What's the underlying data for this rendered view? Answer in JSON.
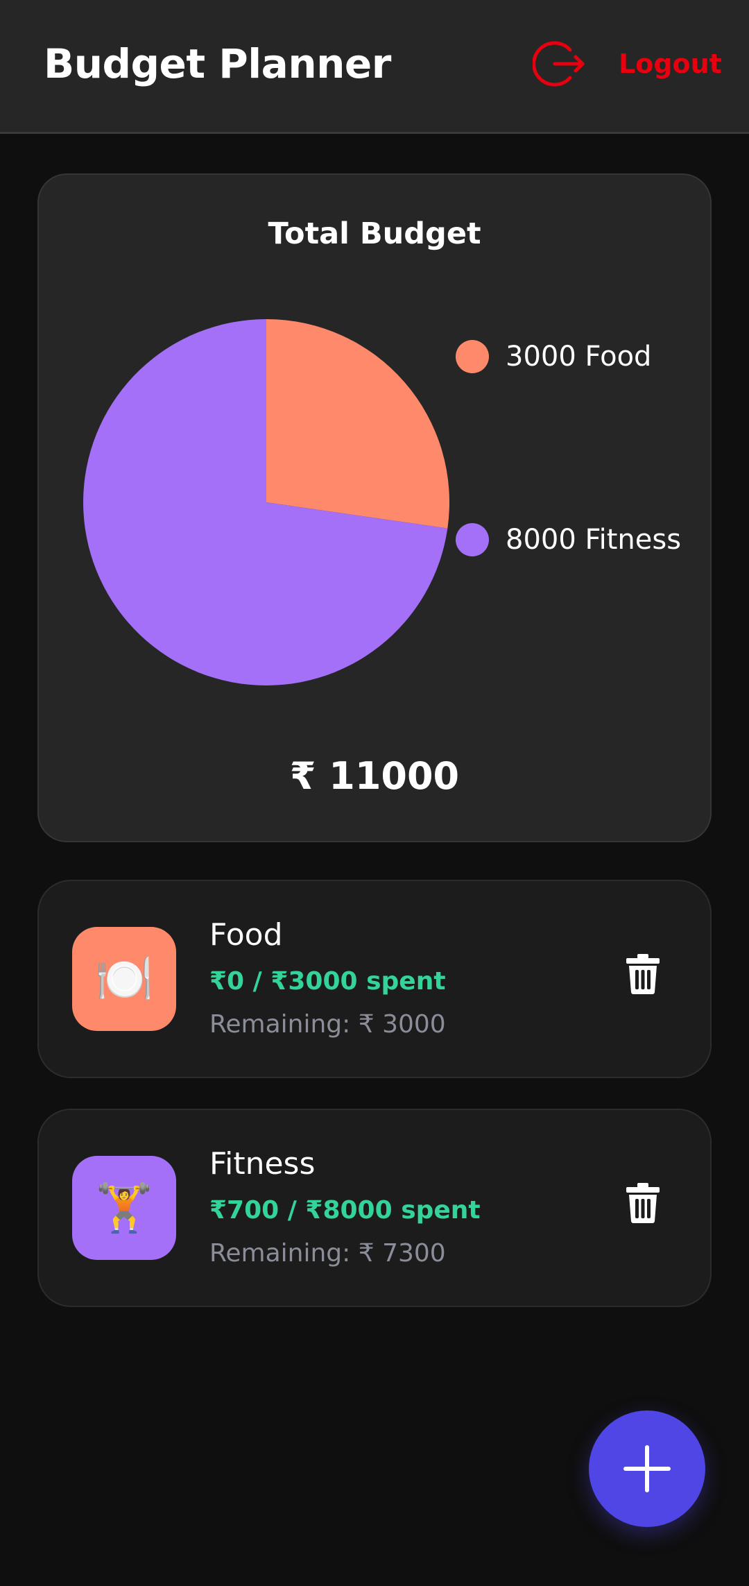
{
  "header": {
    "title": "Budget Planner",
    "logout_label": "Logout",
    "logout_icon": "logout-icon",
    "accent_color": "#e8000f"
  },
  "summary": {
    "title": "Total Budget",
    "total": "₹ 11000"
  },
  "chart_data": {
    "type": "pie",
    "title": "Total Budget",
    "categories": [
      "Food",
      "Fitness"
    ],
    "values": [
      3000,
      8000
    ],
    "colors": [
      "#ff8a6b",
      "#a370f7"
    ],
    "legend": [
      "3000 Food",
      "8000 Fitness"
    ],
    "legend_placement": "right"
  },
  "categories": [
    {
      "name": "Food",
      "spent": "₹0 / ₹3000 spent",
      "remaining": "Remaining: ₹ 3000",
      "icon": "🍽️",
      "icon_name": "plate-icon",
      "color": "#ff8a6b"
    },
    {
      "name": "Fitness",
      "spent": "₹700 / ₹8000 spent",
      "remaining": "Remaining: ₹ 7300",
      "icon": "🏋️",
      "icon_name": "weightlifter-icon",
      "color": "#a370f7"
    }
  ],
  "fab": {
    "icon": "plus-icon",
    "color": "#4f46e5"
  }
}
